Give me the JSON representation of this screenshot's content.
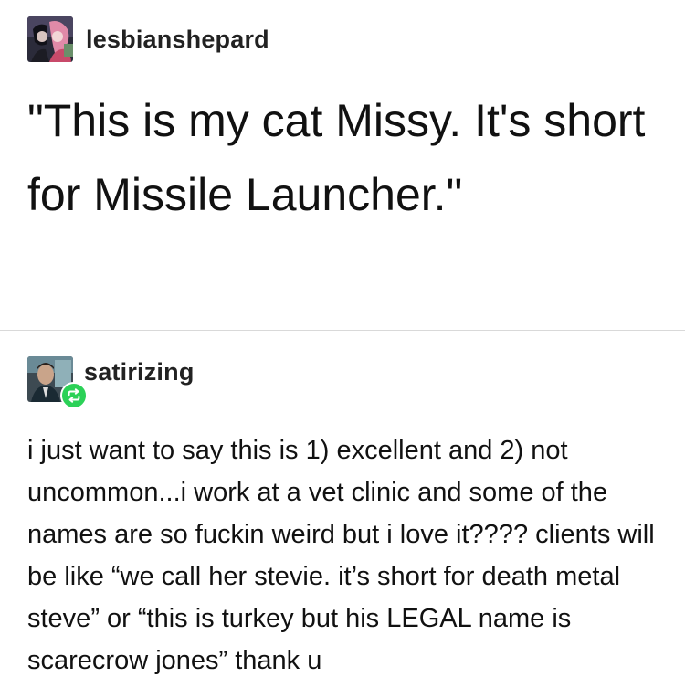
{
  "post1": {
    "username": "lesbianshepard",
    "avatar_icon": "user-avatar",
    "quote": "\"This is my cat Missy. It's short for Missile Launcher.\""
  },
  "post2": {
    "username": "satirizing",
    "avatar_icon": "user-avatar",
    "badge_icon": "reblog-icon",
    "badge_color": "#2bd157",
    "text": "i just want to say this is 1) excellent and 2) not uncommon...i work at a vet clinic and some of the names are so fuckin weird but i love it???? clients will be like “we call her stevie. it’s short for death metal steve” or “this is turkey but his LEGAL name is scarecrow jones” thank u"
  }
}
